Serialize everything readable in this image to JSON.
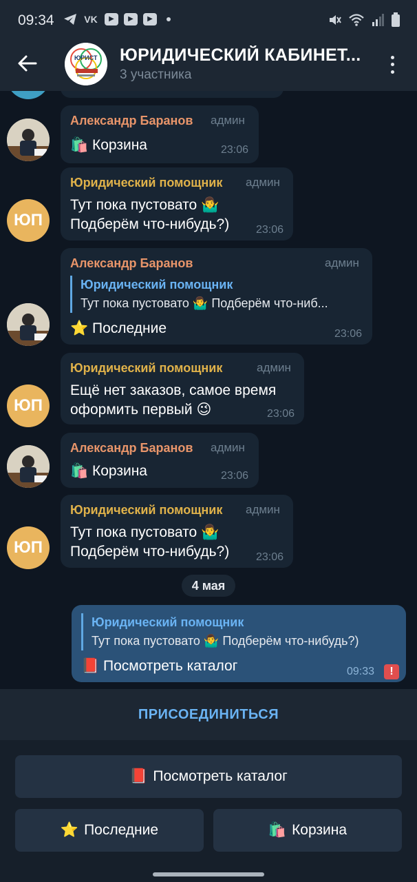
{
  "status_bar": {
    "time": "09:34"
  },
  "header": {
    "title": "ЮРИДИЧЕСКИЙ КАБИНЕТ...",
    "subtitle": "3 участника",
    "avatar_label": "ЮРИСТ"
  },
  "messages": [
    {
      "author": "Александр Баранов",
      "role": "админ",
      "text": "Корзина",
      "icon": "shopping-bags-icon",
      "time": "23:06"
    },
    {
      "author": "Юридический помощник",
      "role": "админ",
      "line1": "Тут пока пустовато",
      "line2": "Подберём что-нибудь?)",
      "icon": "shrug-icon",
      "time": "23:06"
    },
    {
      "author": "Александр Баранов",
      "role": "админ",
      "reply_author": "Юридический помощник",
      "reply_text_a": "Тут пока пустовато",
      "reply_text_b": "Подберём что-ниб...",
      "text": "Последние",
      "icon": "star-icon",
      "time": "23:06"
    },
    {
      "author": "Юридический помощник",
      "role": "админ",
      "line1": "Ещё нет заказов, самое время",
      "line2": "оформить первый",
      "icon": "wink-icon",
      "time": "23:06"
    },
    {
      "author": "Александр Баранов",
      "role": "админ",
      "text": "Корзина",
      "icon": "shopping-bags-icon",
      "time": "23:06"
    },
    {
      "author": "Юридический помощник",
      "role": "админ",
      "line1": "Тут пока пустовато",
      "line2": "Подберём что-нибудь?)",
      "icon": "shrug-icon",
      "time": "23:06"
    }
  ],
  "date_divider": "4 мая",
  "own_message": {
    "reply_author": "Юридический помощник",
    "reply_text_a": "Тут пока пустовато",
    "reply_text_b": "Подберём что-нибудь?)",
    "text": "Посмотреть каталог",
    "icon": "red-book-icon",
    "time": "09:33",
    "status": "!"
  },
  "avatar_initials": "ЮП",
  "join_label": "ПРИСОЕДИНИТЬСЯ",
  "keyboard": {
    "catalog": "Посмотреть каталог",
    "recent": "Последние",
    "cart": "Корзина"
  },
  "colors": {
    "background": "#0e1621",
    "bubble": "#182533",
    "own_bubble": "#2b5278",
    "accent": "#6ab3f3",
    "orange_author": "#e8956a",
    "yellow_author": "#e0b24a"
  }
}
